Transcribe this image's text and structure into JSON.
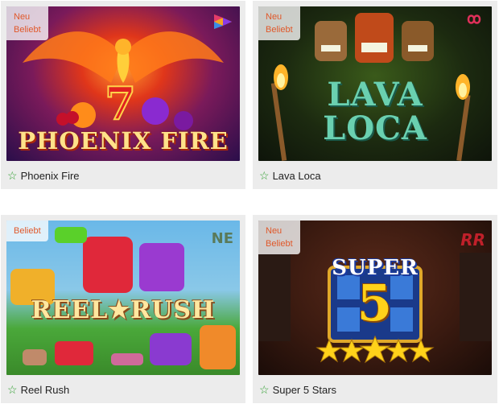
{
  "games": [
    {
      "title": "Phoenix Fire",
      "badges": [
        "Neu",
        "Beliebt"
      ],
      "logo_text": "PHOENIX FIRE",
      "icons": {
        "favorite": "star-outline-icon",
        "provider": "pragmatic-triangle-logo"
      }
    },
    {
      "title": "Lava Loca",
      "badges": [
        "Neu",
        "Beliebt"
      ],
      "logo_line1": "LAVA",
      "logo_line2": "LOCA",
      "icons": {
        "favorite": "star-outline-icon",
        "provider": "infinity-logo"
      }
    },
    {
      "title": "Reel Rush",
      "badges": [
        "Beliebt"
      ],
      "logo_text": "REEL★RUSH",
      "provider_text": "NE",
      "icons": {
        "favorite": "star-outline-icon",
        "provider": "netent-logo"
      }
    },
    {
      "title": "Super 5 Stars",
      "badges": [
        "Neu",
        "Beliebt"
      ],
      "logo_line1": "SUPER",
      "logo_line2": "5",
      "provider_text": "RR",
      "icons": {
        "favorite": "star-outline-icon",
        "provider": "rr-logo"
      }
    }
  ],
  "colors": {
    "badge": "#e0582a",
    "favorite_star": "#2f9e2f",
    "card_bg": "#ececec"
  }
}
